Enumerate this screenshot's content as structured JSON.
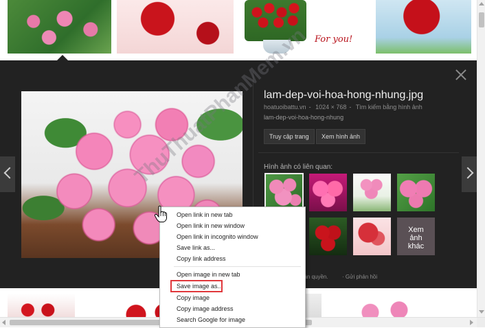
{
  "top_thumbs": {
    "card_text": "For you!"
  },
  "preview": {
    "title": "lam-dep-voi-hoa-hong-nhung.jpg",
    "meta_site": "hoatuoibattu.vn",
    "meta_sep": "-",
    "meta_size": "1024 × 768",
    "meta_search": "Tìm kiếm bằng hình ảnh",
    "description": "lam-dep-voi-hoa-hong-nhung",
    "visit_label": "Truy cập trang",
    "view_label": "Xem hình ảnh",
    "related_label": "Hình ảnh có liên quan:",
    "more_label_1": "Xem",
    "more_label_2": "ảnh",
    "more_label_3": "khác",
    "copyright_text": "bản quyền.",
    "feedback_text": "· Gửi phản hồi"
  },
  "watermark": "ThuThuatPhanMem.vn",
  "context_menu": {
    "items": [
      "Open link in new tab",
      "Open link in new window",
      "Open link in incognito window",
      "Save link as...",
      "Copy link address",
      "Open image in new tab",
      "Save image as...",
      "Copy image",
      "Copy image address",
      "Search Google for image"
    ],
    "highlighted": "Save image as..."
  },
  "colors": {
    "panel_bg": "#222222",
    "highlight": "#e0373b"
  },
  "icons": {
    "close": "close-icon",
    "prev": "chevron-left-icon",
    "next": "chevron-right-icon",
    "cursor": "hand-pointer-icon"
  }
}
